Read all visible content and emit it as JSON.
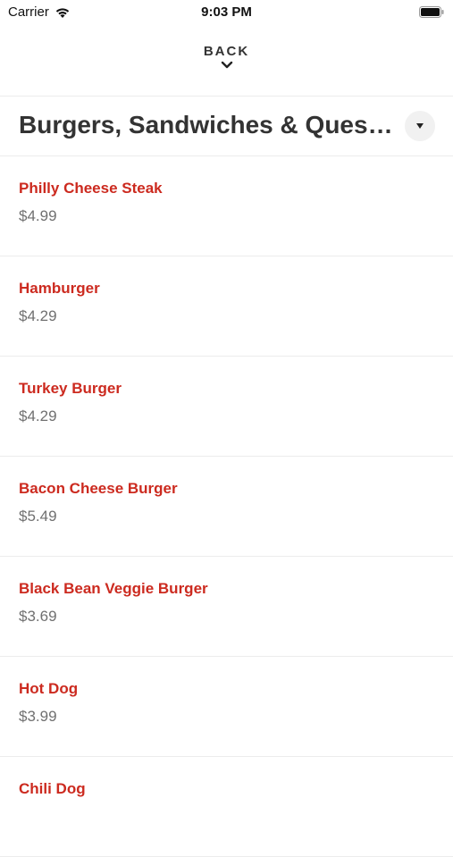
{
  "status_bar": {
    "carrier": "Carrier",
    "time": "9:03 PM"
  },
  "nav": {
    "back_label": "BACK"
  },
  "category": {
    "title": "Burgers, Sandwiches & Quesa..."
  },
  "colors": {
    "item_name": "#cc2a1f",
    "price": "#707070",
    "divider": "#ececec"
  },
  "items": [
    {
      "name": "Philly Cheese Steak",
      "price": "$4.99"
    },
    {
      "name": "Hamburger",
      "price": "$4.29"
    },
    {
      "name": "Turkey Burger",
      "price": "$4.29"
    },
    {
      "name": "Bacon Cheese Burger",
      "price": "$5.49"
    },
    {
      "name": "Black Bean Veggie Burger",
      "price": "$3.69"
    },
    {
      "name": "Hot Dog",
      "price": "$3.99"
    },
    {
      "name": "Chili Dog",
      "price": ""
    }
  ]
}
